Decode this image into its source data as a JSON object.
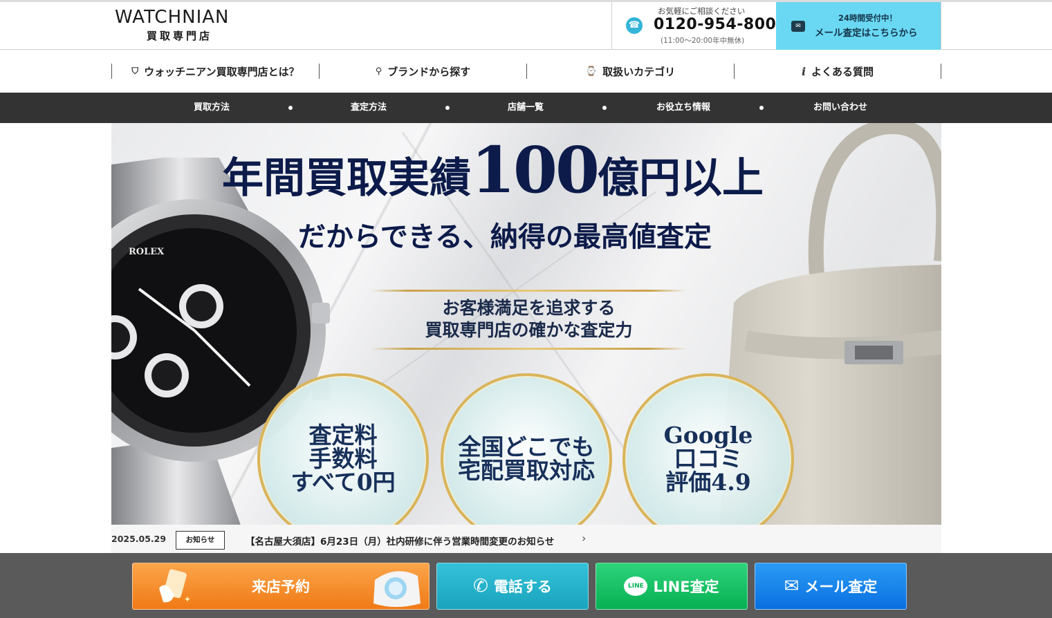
{
  "header": {
    "logo_main": "WATCHNIAN",
    "logo_sub": "買取専門店",
    "tel_note": "お気軽にご相談ください",
    "tel_number": "0120-954-800",
    "tel_hours": "(11:00〜20:00年中無休)",
    "mail_sub": "24時間受付中！",
    "mail_main": "メール査定はこちらから"
  },
  "nav_primary": [
    {
      "label": "ウォッチニアン買取専門店とは？",
      "icon": "shield-icon"
    },
    {
      "label": "ブランドから探す",
      "icon": "search-icon"
    },
    {
      "label": "取扱いカテゴリ",
      "icon": "watch-icon"
    },
    {
      "label": "よくある質問",
      "icon": "info-icon"
    }
  ],
  "nav_secondary": [
    "買取方法",
    "査定方法",
    "店舗一覧",
    "お役立ち情報",
    "お問い合わせ"
  ],
  "hero": {
    "title_pre": "年間買取実績",
    "title_num": "100",
    "title_post": "億円以上",
    "subtitle": "だからできる、納得の最高値査定",
    "catch_line1": "お客様満足を追求する",
    "catch_line2": "買取専門店の確かな査定力",
    "circles": [
      {
        "line1": "査定料",
        "line2": "手数料",
        "line3": "すべて0円"
      },
      {
        "line1": "全国どこでも",
        "line2": "宅配買取対応",
        "line3": ""
      },
      {
        "line1": "Google",
        "line2": "口コミ",
        "line3": "評価4.9"
      }
    ]
  },
  "news": {
    "date": "2025.05.29",
    "badge": "お知らせ",
    "text": "【名古屋大須店】6月23日（月）社内研修に伴う営業時間変更のお知らせ"
  },
  "cta": {
    "visit": "来店予約",
    "tel": "電話する",
    "line": "LINE査定",
    "line_icon_text": "LINE",
    "mail": "メール査定"
  },
  "colors": {
    "accent_cyan": "#6ad8f2",
    "nav_dark": "#333333",
    "navy": "#0c1b4a",
    "gold": "#d9b45a",
    "cta_orange": "#f07a16",
    "cta_teal": "#1aa3bd",
    "cta_green": "#07b053",
    "cta_blue": "#0a6fe0"
  }
}
